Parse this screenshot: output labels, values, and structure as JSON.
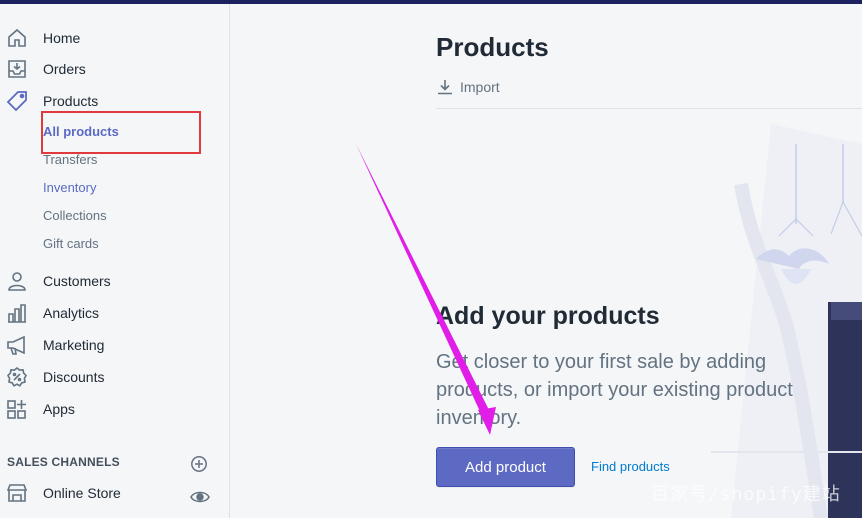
{
  "sidebar": {
    "items": [
      {
        "label": "Home",
        "icon": "home-icon"
      },
      {
        "label": "Orders",
        "icon": "orders-icon"
      },
      {
        "label": "Products",
        "icon": "tag-icon"
      },
      {
        "label": "Customers",
        "icon": "person-icon"
      },
      {
        "label": "Analytics",
        "icon": "bar-chart-icon"
      },
      {
        "label": "Marketing",
        "icon": "megaphone-icon"
      },
      {
        "label": "Discounts",
        "icon": "discount-icon"
      },
      {
        "label": "Apps",
        "icon": "apps-icon"
      }
    ],
    "product_subitems": [
      {
        "label": "All products",
        "active": true
      },
      {
        "label": "Transfers"
      },
      {
        "label": "Inventory"
      },
      {
        "label": "Collections"
      },
      {
        "label": "Gift cards"
      }
    ],
    "sales_channels": {
      "header": "SALES CHANNELS",
      "items": [
        {
          "label": "Online Store",
          "icon": "store-icon"
        }
      ]
    }
  },
  "main": {
    "title": "Products",
    "import_label": "Import",
    "empty_state": {
      "heading": "Add your products",
      "text": "Get closer to your first sale by adding products, or import your existing product inventory.",
      "primary_action": "Add product",
      "secondary_action": "Find products"
    }
  },
  "annotations": {
    "watermark": "百家号/shopify建站"
  },
  "colors": {
    "accent": "#5c6ac4",
    "link": "#007ace",
    "highlight_box": "#e0393e",
    "arrow": "#e11ee8",
    "topbar": "#1c2260"
  }
}
